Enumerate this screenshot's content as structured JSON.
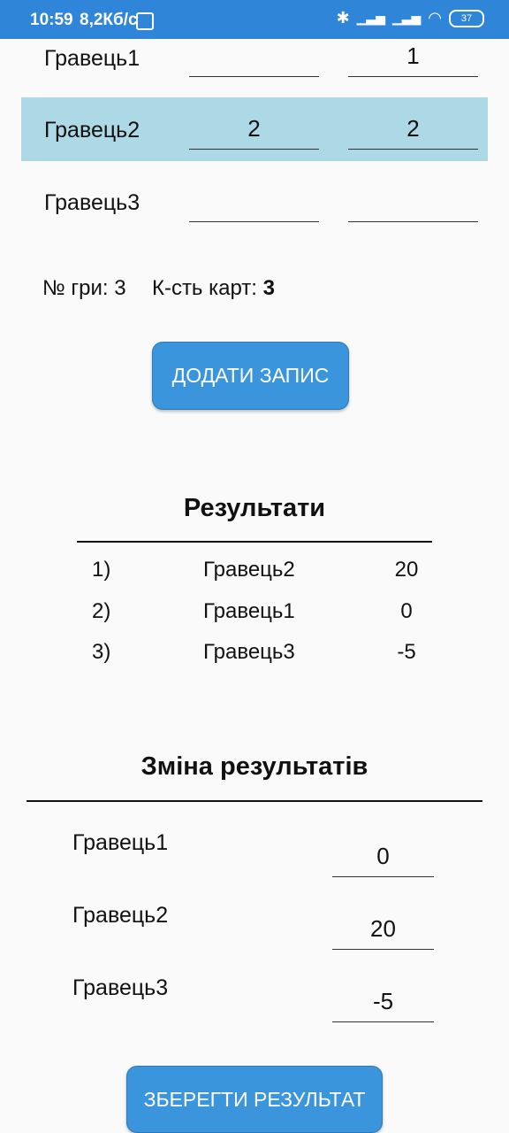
{
  "status_bar": {
    "time": "10:59",
    "network_rate": "8,2Кб/с",
    "battery": "37"
  },
  "players_input": [
    {
      "name": "Гравець1",
      "field1": "",
      "field2": "1",
      "highlighted": false
    },
    {
      "name": "Гравець2",
      "field1": "2",
      "field2": "2",
      "highlighted": true
    },
    {
      "name": "Гравець3",
      "field1": "",
      "field2": "",
      "highlighted": false
    }
  ],
  "game_info": {
    "game_no_label": "№ гри:",
    "game_no": "3",
    "cards_label": "К-сть карт:",
    "cards": "3"
  },
  "add_button": "ДОДАТИ ЗАПИС",
  "results": {
    "title": "Результати",
    "rows": [
      {
        "rank": "1)",
        "name": "Гравець2",
        "score": "20"
      },
      {
        "rank": "2)",
        "name": "Гравець1",
        "score": "0"
      },
      {
        "rank": "3)",
        "name": "Гравець3",
        "score": "-5"
      }
    ]
  },
  "change_results": {
    "title": "Зміна результатів",
    "rows": [
      {
        "name": "Гравець1",
        "value": "0"
      },
      {
        "name": "Гравець2",
        "value": "20"
      },
      {
        "name": "Гравець3",
        "value": "-5"
      }
    ]
  },
  "save_button": "ЗБЕРЕГТИ РЕЗУЛЬТАТ",
  "colors": {
    "status_bar": "#2f86d8",
    "highlight": "#add8e6",
    "button": "#3a95dc"
  }
}
